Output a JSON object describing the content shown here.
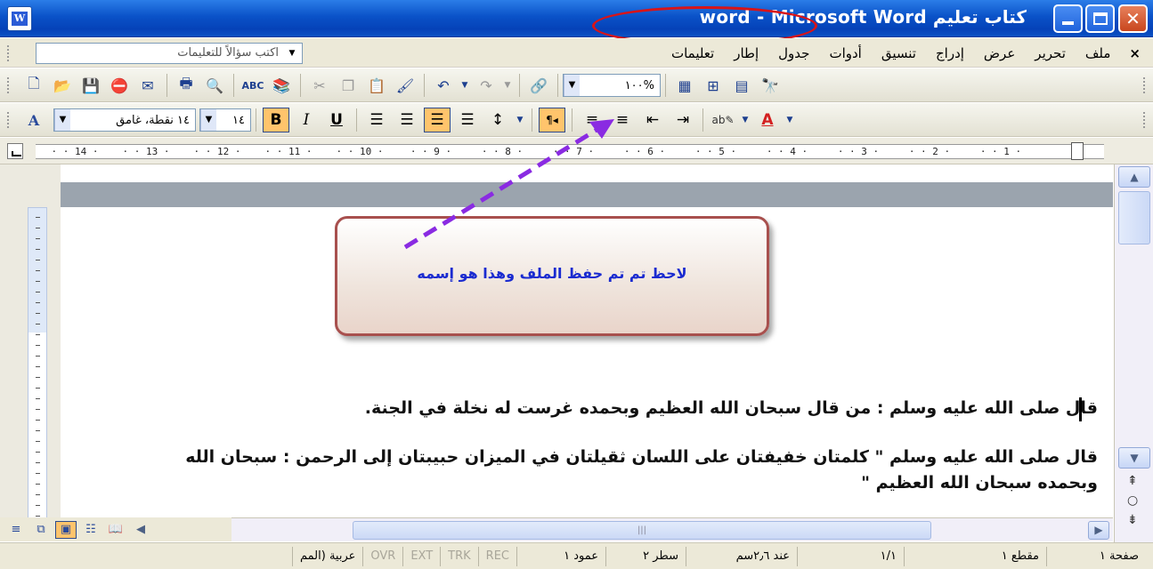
{
  "titlebar": {
    "title_doc": "كتاب تعليم word",
    "title_sep": " - ",
    "title_app": "Microsoft Word",
    "highlight_color": "#d81418"
  },
  "menubar": {
    "items": [
      "ملف",
      "تحرير",
      "عرض",
      "إدراج",
      "تنسيق",
      "أدوات",
      "جدول",
      "إطار",
      "تعليمات"
    ],
    "close_glyph": "×",
    "help_placeholder": "اكتب سؤالاً للتعليمات"
  },
  "standard_toolbar": {
    "zoom_value": "%١٠٠"
  },
  "formatting_toolbar": {
    "style_value": "١٤ نقطة، غامق",
    "size_value": "١٤",
    "bold": "B",
    "italic": "I",
    "underline": "U",
    "font_color": "A",
    "styles_glyph": "A"
  },
  "ruler": {
    "ticks": [
      "14",
      "13",
      "12",
      "11",
      "10",
      "9",
      "8",
      "7",
      "6",
      "5",
      "4",
      "3",
      "2",
      "1"
    ]
  },
  "callout": {
    "text": "لاحظ تم تم حفظ الملف وهذا هو إسمه",
    "text_color": "#1a2bd0",
    "border_color": "#a8504e"
  },
  "document": {
    "paragraph_1": "قال صلى الله عليه وسلم : من قال سبحان الله العظيم وبحمده غرست له نخلة في الجنة.",
    "paragraph_2": "قال صلى الله عليه وسلم \" كلمتان خفيفتان على اللسان ثقيلتان في الميزان حبيبتان إلى الرحمن : سبحان الله وبحمده سبحان الله العظيم \""
  },
  "statusbar": {
    "page": "صفحة ١",
    "section": "مقطع ١",
    "page_of": "١/١",
    "at": "عند ٢٫٦سم",
    "line": "سطر ٢",
    "column": "عمود ١",
    "rec": "REC",
    "trk": "TRK",
    "ext": "EXT",
    "ovr": "OVR",
    "language": "عربية (المم"
  },
  "annotation": {
    "arrow_color": "#8a2be2"
  }
}
